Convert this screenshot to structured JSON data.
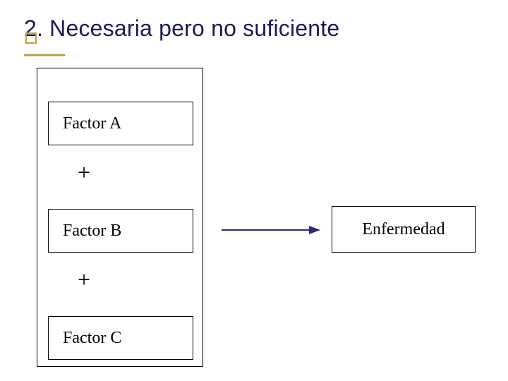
{
  "title": "2. Necesaria pero no suficiente",
  "factors": {
    "a": "Factor A",
    "b": "Factor B",
    "c": "Factor C"
  },
  "operators": {
    "plus1": "+",
    "plus2": "+"
  },
  "outcome": "Enfermedad",
  "colors": {
    "title": "#1a1a5c",
    "accent": "#b8a23c",
    "arrow": "#2a2a78"
  }
}
